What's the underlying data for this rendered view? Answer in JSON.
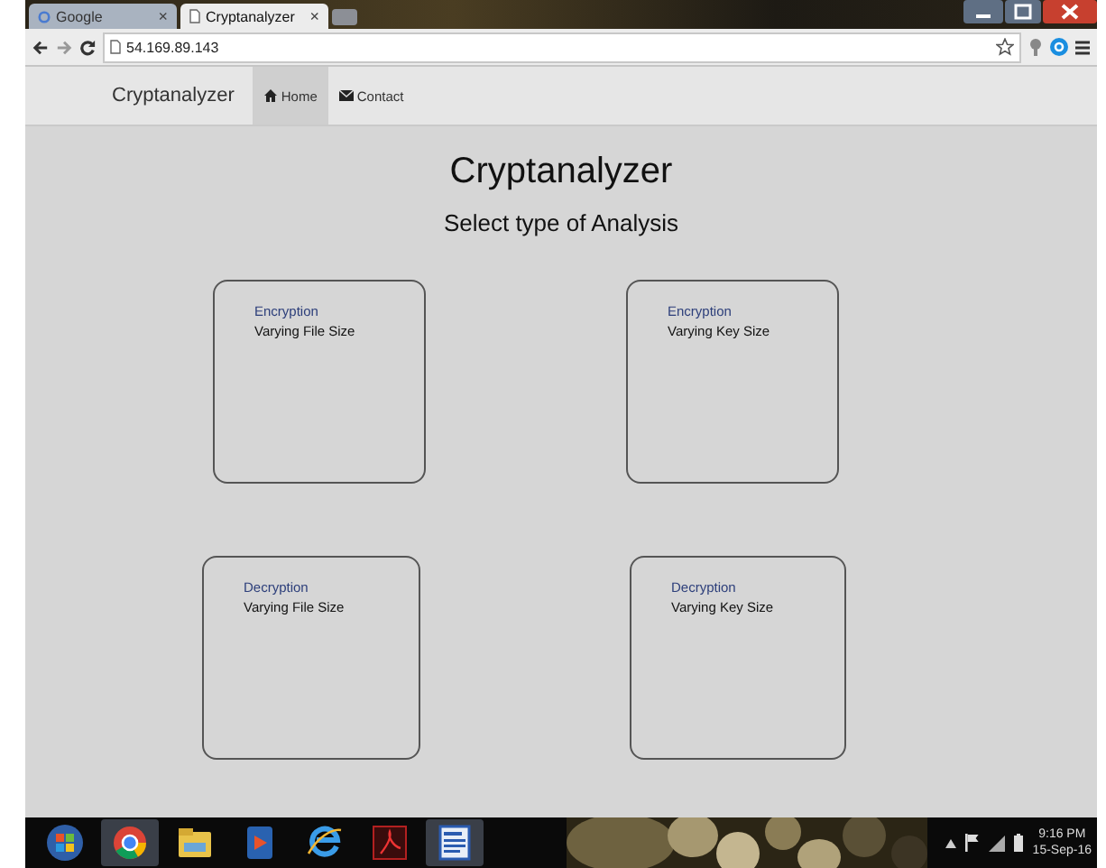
{
  "browser": {
    "tabs": [
      {
        "title": "Google",
        "close": "×",
        "selected": false
      },
      {
        "title": "Cryptanalyzer",
        "close": "×",
        "selected": true
      }
    ],
    "address": "54.169.89.143"
  },
  "navbar": {
    "brand": "Cryptanalyzer",
    "items": [
      {
        "label": "Home",
        "selected": true
      },
      {
        "label": "Contact",
        "selected": false
      }
    ]
  },
  "page": {
    "title": "Cryptanalyzer",
    "subtitle": "Select type of Analysis",
    "cards": [
      {
        "title": "Encryption",
        "subtitle": "Varying File Size"
      },
      {
        "title": "Encryption",
        "subtitle": "Varying Key Size"
      },
      {
        "title": "Decryption",
        "subtitle": "Varying File Size"
      },
      {
        "title": "Decryption",
        "subtitle": "Varying Key Size"
      }
    ]
  },
  "taskbar": {
    "time": "9:16 PM",
    "date": "15-Sep-16"
  }
}
